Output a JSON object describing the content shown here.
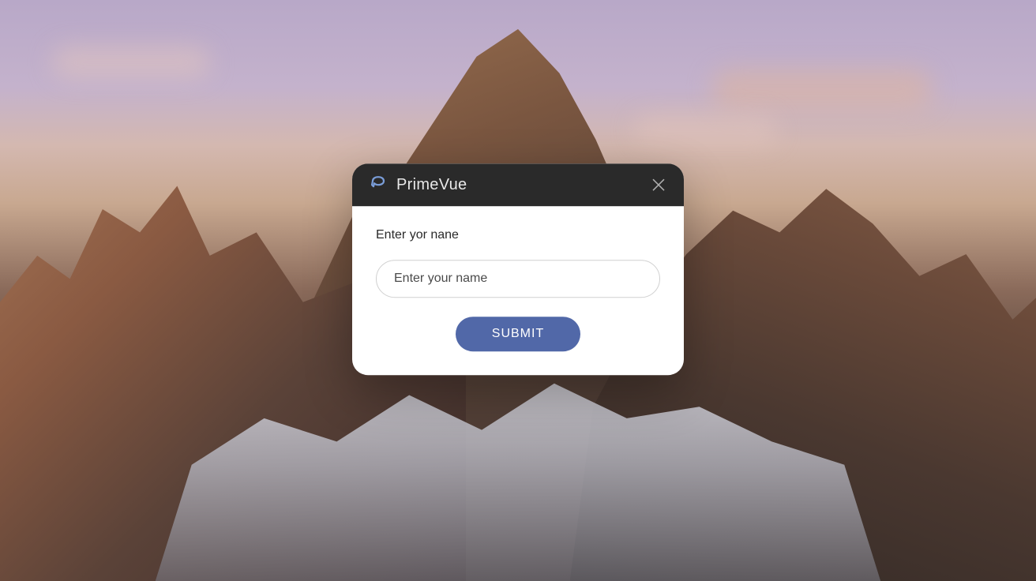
{
  "dialog": {
    "brand_name": "PrimeVue",
    "field_label": "Enter yor nane",
    "input_placeholder": "Enter your name",
    "input_value": "",
    "submit_label": "SUBMIT"
  },
  "colors": {
    "accent": "#5168a8",
    "header_bg": "#2a2a2a",
    "dialog_bg": "#ffffff"
  }
}
